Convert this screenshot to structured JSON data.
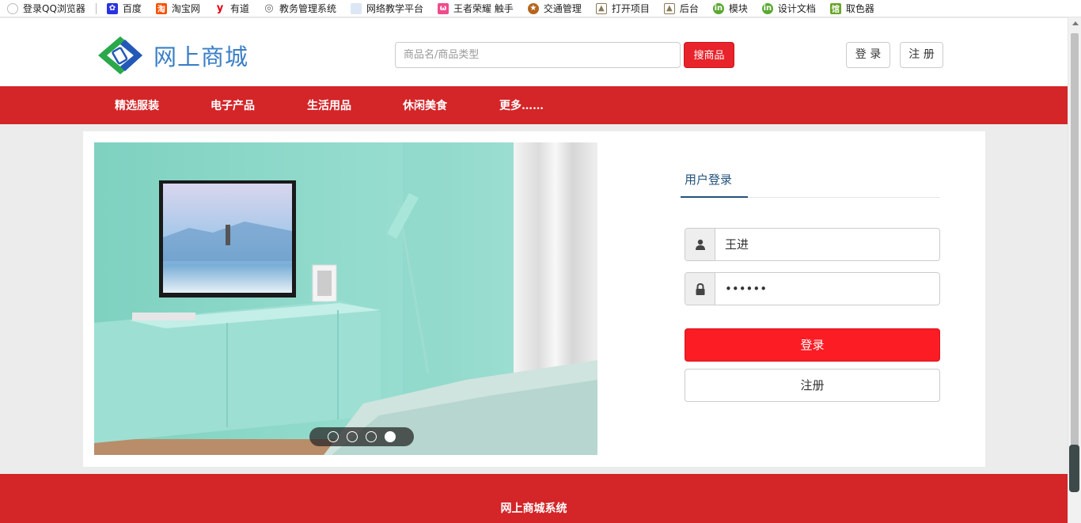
{
  "bookmarks": [
    {
      "label": "登录QQ浏览器",
      "icon": "user-avatar-icon",
      "color": "#cfcfcf"
    },
    {
      "label": "百度",
      "icon": "baidu-paw-icon",
      "color": "#2932e1"
    },
    {
      "label": "淘宝网",
      "icon": "taobao-icon",
      "color": "#ff5000"
    },
    {
      "label": "有道",
      "icon": "youdao-icon",
      "color": "#e60012"
    },
    {
      "label": "教务管理系统",
      "icon": "globe-icon",
      "color": "#666666"
    },
    {
      "label": "网络教学平台",
      "icon": "blank-page-icon",
      "color": "#dde6f5"
    },
    {
      "label": "王者荣耀 触手",
      "icon": "chushou-icon",
      "color": "#f04b8c"
    },
    {
      "label": "交通管理",
      "icon": "police-badge-icon",
      "color": "#b5651d"
    },
    {
      "label": "打开项目",
      "icon": "image-file-icon",
      "color": "#8a7a5a"
    },
    {
      "label": "后台",
      "icon": "image-file-icon",
      "color": "#8a7a5a"
    },
    {
      "label": "模块",
      "icon": "green-circle-icon",
      "color": "#5aa832"
    },
    {
      "label": "设计文档",
      "icon": "green-circle-icon",
      "color": "#5aa832"
    },
    {
      "label": "取色器",
      "icon": "color-picker-icon",
      "color": "#6aa62a"
    }
  ],
  "header": {
    "logo_text": "网上商城",
    "search_placeholder": "商品名/商品类型",
    "search_button": "搜商品",
    "login_button": "登 录",
    "register_button": "注 册"
  },
  "nav": {
    "items": [
      "精选服装",
      "电子产品",
      "生活用品",
      "休闲美食",
      "更多……"
    ]
  },
  "carousel": {
    "slide_count": 4,
    "active_slide": 4
  },
  "login": {
    "tab_label": "用户登录",
    "username_value": "王进",
    "password_value": "••••••",
    "login_button": "登录",
    "register_button": "注册"
  },
  "footer": {
    "text": "网上商城系统"
  },
  "colors": {
    "brand_red": "#d42528",
    "button_red": "#fb1c24",
    "logo_blue": "#3a7fc6",
    "tab_blue": "#23527c"
  }
}
